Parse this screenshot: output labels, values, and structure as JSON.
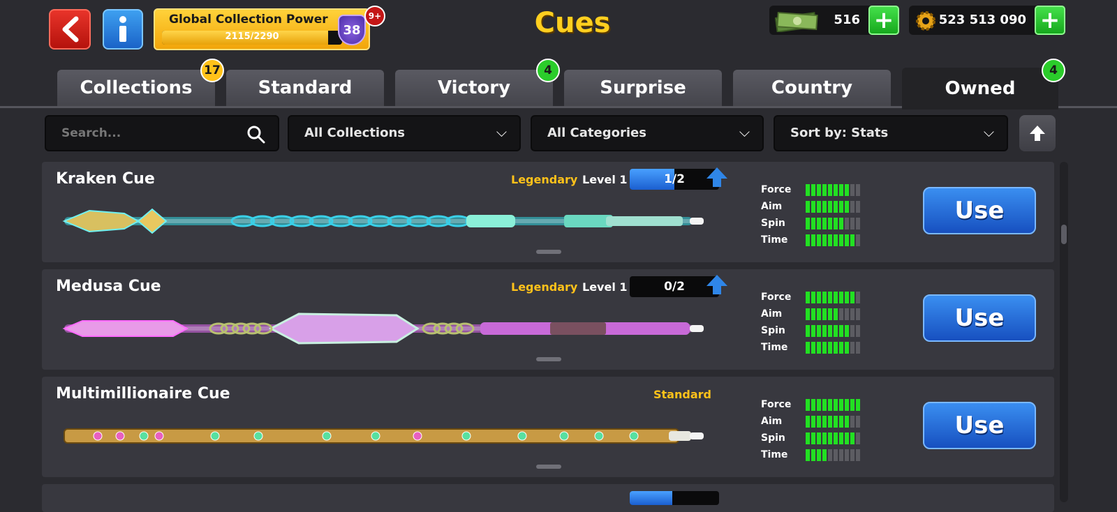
{
  "header": {
    "title": "Cues",
    "power_label": "Global Collection Power",
    "power_progress": "2115/2290",
    "power_fraction": 0.9236,
    "power_level": "38",
    "notification_badge": "9+",
    "cash_value": "516",
    "coins_value": "523 513 090",
    "plus": "+"
  },
  "tabs": [
    {
      "label": "Collections",
      "badge": "17"
    },
    {
      "label": "Standard",
      "badge": ""
    },
    {
      "label": "Victory",
      "badge": "4"
    },
    {
      "label": "Surprise",
      "badge": ""
    },
    {
      "label": "Country",
      "badge": ""
    },
    {
      "label": "Owned",
      "badge": "4",
      "active": true
    }
  ],
  "filters": {
    "search_placeholder": "Search...",
    "collection": "All Collections",
    "category": "All Categories",
    "sort": "Sort by: Stats"
  },
  "stat_labels": [
    "Force",
    "Aim",
    "Spin",
    "Time"
  ],
  "cues": [
    {
      "name": "Kraken Cue",
      "rarity": "Legendary",
      "level": "Level 1",
      "progress": "1/2",
      "progress_fraction": 0.5,
      "stats": {
        "Force": 8,
        "Aim": 8,
        "Spin": 7,
        "Time": 9
      },
      "use_label": "Use",
      "color": "#2fd6e0"
    },
    {
      "name": "Medusa Cue",
      "rarity": "Legendary",
      "level": "Level 1",
      "progress": "0/2",
      "progress_fraction": 0,
      "stats": {
        "Force": 9,
        "Aim": 6,
        "Spin": 8,
        "Time": 8
      },
      "use_label": "Use",
      "color": "#e06af0"
    },
    {
      "name": "Multimillionaire Cue",
      "rarity": "Standard",
      "level": "",
      "progress": "",
      "progress_fraction": null,
      "stats": {
        "Force": 10,
        "Aim": 8,
        "Spin": 9,
        "Time": 4
      },
      "use_label": "Use",
      "color": "#d8a43a"
    }
  ],
  "stat_max": 10
}
